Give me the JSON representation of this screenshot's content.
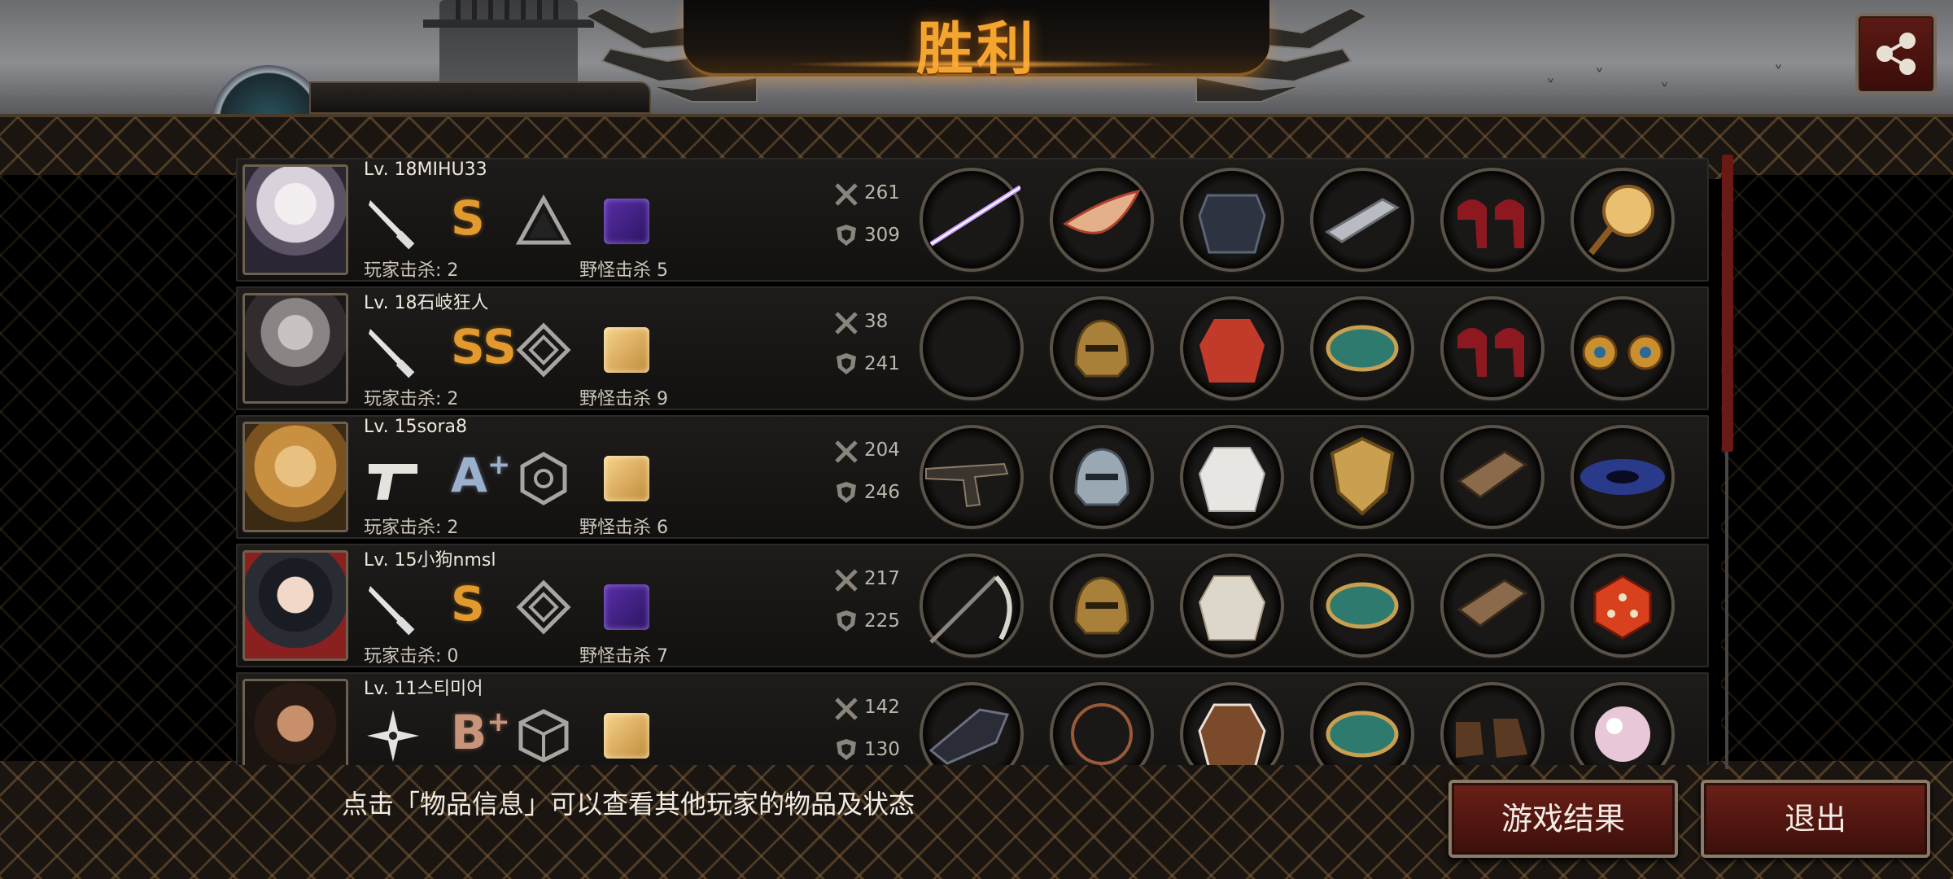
{
  "header": {
    "title": "胜利"
  },
  "hint_text": "点击「物品信息」可以查看其他玩家的物品及状态",
  "buttons": {
    "results": "游戏结果",
    "exit": "退出"
  },
  "players": [
    {
      "level_name": "Lv. 18MIHU33",
      "weapon": "knife",
      "rank": "S",
      "rank_plus": "",
      "emblem": "triangle",
      "card": "purple",
      "player_kills": "玩家击杀: 2",
      "monster_kills": "野怪击杀 5",
      "attack": "261",
      "defense": "309"
    },
    {
      "level_name": "Lv. 18石岐狂人",
      "weapon": "knife",
      "rank": "SS",
      "rank_plus": "",
      "emblem": "diamond",
      "card": "gold",
      "player_kills": "玩家击杀: 2",
      "monster_kills": "野怪击杀 9",
      "attack": "38",
      "defense": "241"
    },
    {
      "level_name": "Lv. 15sora8",
      "weapon": "pistol",
      "rank": "A",
      "rank_plus": "+",
      "emblem": "hexagon",
      "card": "gold",
      "player_kills": "玩家击杀: 2",
      "monster_kills": "野怪击杀 6",
      "attack": "204",
      "defense": "246"
    },
    {
      "level_name": "Lv. 15小狗nmsl",
      "weapon": "knife",
      "rank": "S",
      "rank_plus": "",
      "emblem": "diamond",
      "card": "purple",
      "player_kills": "玩家击杀: 0",
      "monster_kills": "野怪击杀 7",
      "attack": "217",
      "defense": "225"
    },
    {
      "level_name": "Lv. 11스티미어",
      "weapon": "shuriken",
      "rank": "B",
      "rank_plus": "+",
      "emblem": "cube",
      "card": "gold",
      "player_kills": "",
      "monster_kills": "",
      "attack": "142",
      "defense": "130"
    }
  ],
  "colors": {
    "gold_text": "#f3a530",
    "button_red": "#6b2018",
    "rank_s": "#e29a2e"
  }
}
